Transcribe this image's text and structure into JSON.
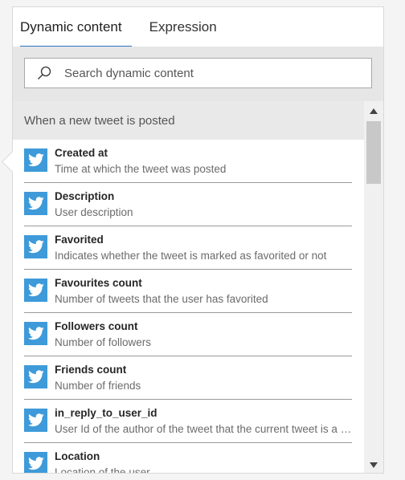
{
  "tabs": [
    {
      "label": "Dynamic content",
      "active": true
    },
    {
      "label": "Expression",
      "active": false
    }
  ],
  "search": {
    "placeholder": "Search dynamic content",
    "value": ""
  },
  "section": {
    "title": "When a new tweet is posted"
  },
  "items": [
    {
      "title": "Created at",
      "description": "Time at which the tweet was posted",
      "icon": "twitter-icon"
    },
    {
      "title": "Description",
      "description": "User description",
      "icon": "twitter-icon"
    },
    {
      "title": "Favorited",
      "description": "Indicates whether the tweet is marked as favorited or not",
      "icon": "twitter-icon"
    },
    {
      "title": "Favourites count",
      "description": "Number of tweets that the user has favorited",
      "icon": "twitter-icon"
    },
    {
      "title": "Followers count",
      "description": "Number of followers",
      "icon": "twitter-icon"
    },
    {
      "title": "Friends count",
      "description": "Number of friends",
      "icon": "twitter-icon"
    },
    {
      "title": "in_reply_to_user_id",
      "description": "User Id of the author of the tweet that the current tweet is a reply to",
      "icon": "twitter-icon"
    },
    {
      "title": "Location",
      "description": "Location of the user",
      "icon": "twitter-icon"
    }
  ],
  "colors": {
    "accent": "#2b73c5",
    "twitter": "#3e9ad9"
  }
}
